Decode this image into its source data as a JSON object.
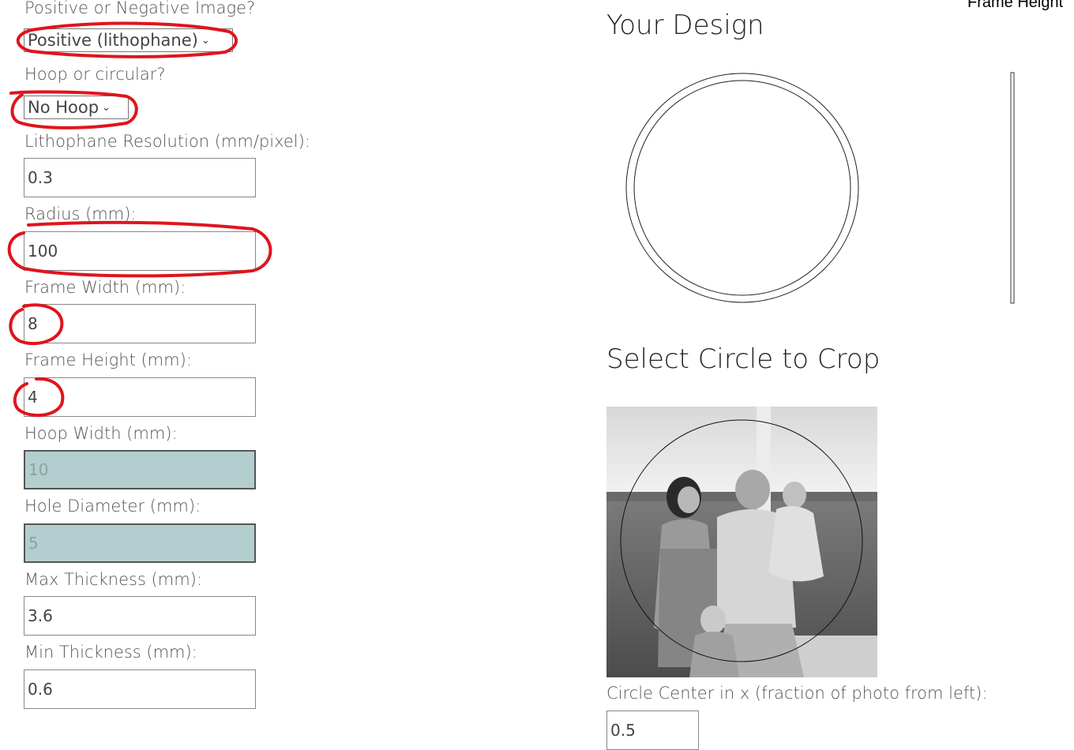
{
  "form": {
    "positive_label": "Positive or Negative Image?",
    "positive_value": "Positive (lithophane)",
    "hoop_label": "Hoop or circular?",
    "hoop_value": "No Hoop",
    "resolution_label": "Lithophane Resolution (mm/pixel):",
    "resolution_value": "0.3",
    "radius_label": "Radius (mm):",
    "radius_value": "100",
    "frame_width_label": "Frame Width (mm):",
    "frame_width_value": "8",
    "frame_height_label": "Frame Height (mm):",
    "frame_height_value": "4",
    "hoop_width_label": "Hoop Width (mm):",
    "hoop_width_value": "10",
    "hole_diameter_label": "Hole Diameter (mm):",
    "hole_diameter_value": "5",
    "max_thickness_label": "Max Thickness (mm):",
    "max_thickness_value": "3.6",
    "min_thickness_label": "Min Thickness (mm):",
    "min_thickness_value": "0.6"
  },
  "design": {
    "title": "Your Design",
    "frame_height_caption": "Frame Height"
  },
  "crop": {
    "title": "Select Circle to Crop",
    "center_x_label": "Circle Center in x (fraction of photo from left):",
    "center_x_value": "0.5"
  },
  "colors": {
    "annotation": "#e0141c",
    "disabled_field": "#b3cece"
  },
  "icons": {
    "select_arrow": "chevron-down-icon"
  }
}
